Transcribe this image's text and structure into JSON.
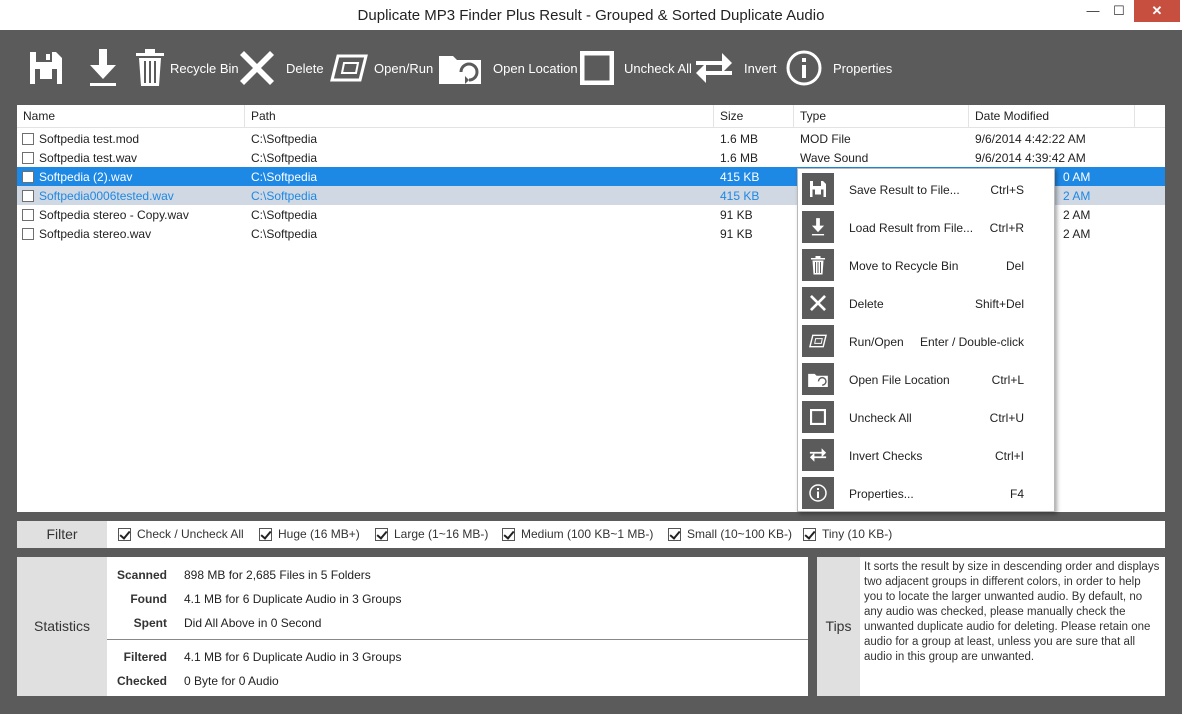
{
  "window": {
    "title": "Duplicate MP3 Finder Plus Result - Grouped & Sorted Duplicate Audio",
    "minimize": "—",
    "maximize": "☐",
    "close": "✕"
  },
  "toolbar": {
    "save_icon": "floppy-disk-icon",
    "load_icon": "download-arrow-icon",
    "recycle_label": "Recycle Bin",
    "delete_label": "Delete",
    "open_run_label": "Open/Run",
    "open_location_label": "Open Location",
    "uncheck_all_label": "Uncheck All",
    "invert_label": "Invert",
    "properties_label": "Properties"
  },
  "list": {
    "columns": [
      "Name",
      "Path",
      "Size",
      "Type",
      "Date Modified"
    ],
    "rows": [
      {
        "name": "Softpedia test.mod",
        "path": "C:\\Softpedia",
        "size": "1.6 MB",
        "type": "MOD File",
        "date": "9/6/2014 4:42:22 AM",
        "state": "normal"
      },
      {
        "name": "Softpedia test.wav",
        "path": "C:\\Softpedia",
        "size": "1.6 MB",
        "type": "Wave Sound",
        "date": "9/6/2014 4:39:42 AM",
        "state": "normal"
      },
      {
        "name": "Softpedia (2).wav",
        "path": "C:\\Softpedia",
        "size": "415 KB",
        "type": "",
        "date": "0 AM",
        "state": "selected"
      },
      {
        "name": "Softpedia0006tested.wav",
        "path": "C:\\Softpedia",
        "size": "415 KB",
        "type": "",
        "date": "2 AM",
        "state": "group-alt"
      },
      {
        "name": "Softpedia stereo - Copy.wav",
        "path": "C:\\Softpedia",
        "size": "91 KB",
        "type": "",
        "date": "2 AM",
        "state": "normal"
      },
      {
        "name": "Softpedia stereo.wav",
        "path": "C:\\Softpedia",
        "size": "91 KB",
        "type": "",
        "date": "2 AM",
        "state": "normal"
      }
    ]
  },
  "context_menu": [
    {
      "label": "Save Result to File...",
      "shortcut": "Ctrl+S",
      "icon": "floppy-disk-icon"
    },
    {
      "label": "Load Result from File...",
      "shortcut": "Ctrl+R",
      "icon": "download-arrow-icon"
    },
    {
      "label": "Move to Recycle Bin",
      "shortcut": "Del",
      "icon": "trash-icon"
    },
    {
      "label": "Delete",
      "shortcut": "Shift+Del",
      "icon": "x-icon"
    },
    {
      "label": "Run/Open",
      "shortcut": "Enter / Double-click",
      "icon": "run-icon"
    },
    {
      "label": "Open File Location",
      "shortcut": "Ctrl+L",
      "icon": "folder-icon"
    },
    {
      "label": "Uncheck All",
      "shortcut": "Ctrl+U",
      "icon": "square-icon"
    },
    {
      "label": "Invert Checks",
      "shortcut": "Ctrl+I",
      "icon": "swap-arrows-icon"
    },
    {
      "label": "Properties...",
      "shortcut": "F4",
      "icon": "info-icon"
    }
  ],
  "filter": {
    "label": "Filter",
    "options": [
      "Check / Uncheck All",
      "Huge (16 MB+)",
      "Large (1~16 MB-)",
      "Medium (100 KB~1 MB-)",
      "Small (10~100 KB-)",
      "Tiny (10 KB-)"
    ]
  },
  "statistics": {
    "label": "Statistics",
    "scanned_key": "Scanned",
    "scanned": "898 MB for 2,685 Files in 5 Folders",
    "found_key": "Found",
    "found": "4.1 MB for 6 Duplicate Audio in 3 Groups",
    "spent_key": "Spent",
    "spent": "Did All Above in 0 Second",
    "filtered_key": "Filtered",
    "filtered": "4.1 MB for 6 Duplicate Audio in 3 Groups",
    "checked_key": "Checked",
    "checked": "0 Byte for 0 Audio"
  },
  "tips": {
    "label": "Tips",
    "text": "It sorts the result by size in descending order and displays two adjacent groups in different colors, in order to help you to locate the larger unwanted audio. By default, no any audio was checked, please manually check the unwanted duplicate audio for deleting. Please retain one audio for a group at least, unless you are sure that all audio in this group are unwanted."
  },
  "colors": {
    "background": "#5b5b5b",
    "selection": "#1e88e5",
    "group_alt": "#cfd8e3",
    "close_button": "#c74f3f"
  }
}
